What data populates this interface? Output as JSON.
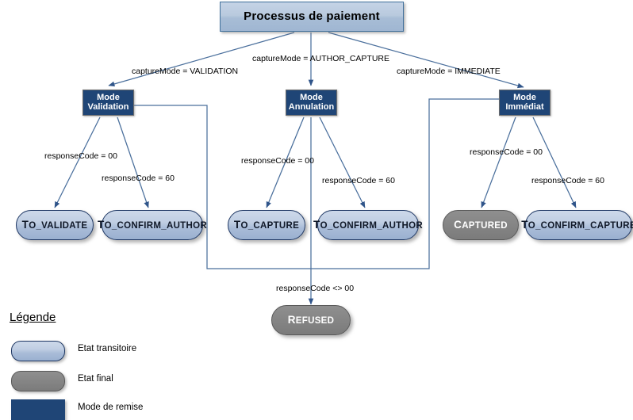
{
  "diagram": {
    "title_node": {
      "label": "Processus de paiement"
    },
    "modes": [
      {
        "id": "mode-validation",
        "line1": "Mode",
        "line2": "Validation"
      },
      {
        "id": "mode-annulation",
        "line1": "Mode",
        "line2": "Annulation"
      },
      {
        "id": "mode-immediat",
        "line1": "Mode",
        "line2": "Immédiat"
      }
    ],
    "mode_edge_labels": [
      {
        "text": "captureMode = VALIDATION"
      },
      {
        "text": "captureMode = AUTHOR_CAPTURE"
      },
      {
        "text": "captureMode = IMMEDIATE"
      }
    ],
    "response_edge_labels": [
      {
        "text": "responseCode = 00"
      },
      {
        "text": "responseCode = 60"
      },
      {
        "text": "responseCode = 00"
      },
      {
        "text": "responseCode = 60"
      },
      {
        "text": "responseCode = 00"
      },
      {
        "text": "responseCode = 60"
      },
      {
        "text": "responseCode <> 00"
      }
    ],
    "states": [
      {
        "id": "to-validate",
        "first": "T",
        "rest": "O_VALIDATE",
        "kind": "transitory"
      },
      {
        "id": "to-confirm-author-1",
        "first": "T",
        "rest": "O_CONFIRM_AUTHOR",
        "kind": "transitory"
      },
      {
        "id": "to-capture",
        "first": "T",
        "rest": "O_CAPTURE",
        "kind": "transitory"
      },
      {
        "id": "to-confirm-author-2",
        "first": "T",
        "rest": "O_CONFIRM_AUTHOR",
        "kind": "transitory"
      },
      {
        "id": "captured",
        "first": "C",
        "rest": "APTURED",
        "kind": "final"
      },
      {
        "id": "to-confirm-capture",
        "first": "T",
        "rest": "O_CONFIRM_CAPTURE",
        "kind": "transitory"
      },
      {
        "id": "refused",
        "first": "R",
        "rest": "EFUSED",
        "kind": "final"
      }
    ],
    "legend": {
      "title": "Légende",
      "items": [
        {
          "swatch": "transitory",
          "label": "Etat transitoire"
        },
        {
          "swatch": "final",
          "label": "Etat final"
        },
        {
          "swatch": "mode",
          "label": "Mode de remise"
        }
      ]
    },
    "colors": {
      "mode_fill": "#1f4576",
      "state_border": "#1f3864",
      "final_fill": "#858585",
      "edge_line": "#4a6f9c",
      "background": "#ffffff"
    }
  }
}
